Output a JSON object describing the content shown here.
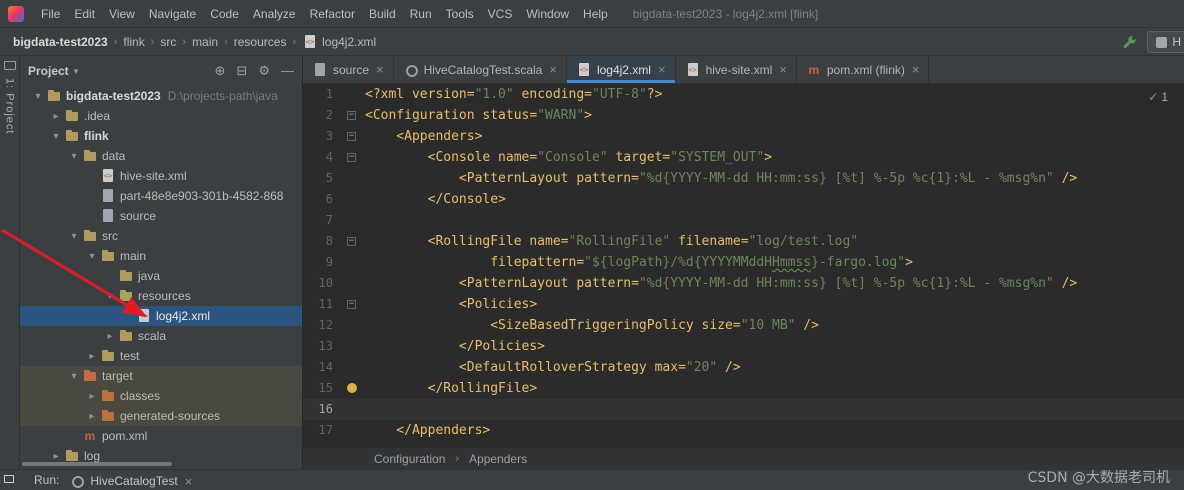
{
  "title_bar": {
    "menus": [
      "File",
      "Edit",
      "View",
      "Navigate",
      "Code",
      "Analyze",
      "Refactor",
      "Build",
      "Run",
      "Tools",
      "VCS",
      "Window",
      "Help"
    ],
    "window_title": "bigdata-test2023 - log4j2.xml [flink]"
  },
  "nav_bar": {
    "breadcrumbs": [
      "bigdata-test2023",
      "flink",
      "src",
      "main",
      "resources",
      "log4j2.xml"
    ],
    "run_widget_label": "H"
  },
  "tool_strip": {
    "label": "1: Project"
  },
  "project_panel": {
    "title": "Project",
    "tools": [
      {
        "name": "locate",
        "glyph": "⊕"
      },
      {
        "name": "collapse-all",
        "glyph": "⊟"
      },
      {
        "name": "settings",
        "glyph": "⚙"
      },
      {
        "name": "hide",
        "glyph": "—"
      }
    ],
    "tree": [
      {
        "label": "bigdata-test2023",
        "sub": "D:\\projects-path\\java",
        "icon": "folder",
        "indent": 0,
        "chevron": "down",
        "bold": true
      },
      {
        "label": ".idea",
        "icon": "folder",
        "indent": 1,
        "chevron": "right"
      },
      {
        "label": "flink",
        "icon": "folder",
        "indent": 1,
        "chevron": "down",
        "bold": true
      },
      {
        "label": "data",
        "icon": "folder",
        "indent": 2,
        "chevron": "down"
      },
      {
        "label": "hive-site.xml",
        "icon": "xml",
        "indent": 3
      },
      {
        "label": "part-48e8e903-301b-4582-868",
        "icon": "file",
        "indent": 3
      },
      {
        "label": "source",
        "icon": "file",
        "indent": 3
      },
      {
        "label": "src",
        "icon": "folder",
        "indent": 2,
        "chevron": "down"
      },
      {
        "label": "main",
        "icon": "folder",
        "indent": 3,
        "chevron": "down"
      },
      {
        "label": "java",
        "icon": "folder",
        "indent": 4
      },
      {
        "label": "resources",
        "icon": "folder-res",
        "indent": 4,
        "chevron": "down"
      },
      {
        "label": "log4j2.xml",
        "icon": "xml",
        "indent": 5,
        "selected": true
      },
      {
        "label": "scala",
        "icon": "folder",
        "indent": 4,
        "chevron": "right"
      },
      {
        "label": "test",
        "icon": "folder",
        "indent": 3,
        "chevron": "right"
      },
      {
        "label": "target",
        "icon": "folder-ex",
        "indent": 2,
        "chevron": "down",
        "band": true
      },
      {
        "label": "classes",
        "icon": "folder-ex",
        "indent": 3,
        "chevron": "right",
        "band": true
      },
      {
        "label": "generated-sources",
        "icon": "folder-ex",
        "indent": 3,
        "chevron": "right",
        "band": true
      },
      {
        "label": "pom.xml",
        "icon": "maven",
        "indent": 2
      },
      {
        "label": "log",
        "icon": "folder",
        "indent": 1,
        "chevron": "right"
      }
    ]
  },
  "editor_tabs": [
    {
      "label": "source",
      "icon": "file"
    },
    {
      "label": "HiveCatalogTest.scala",
      "icon": "scala"
    },
    {
      "label": "log4j2.xml",
      "icon": "xml",
      "active": true
    },
    {
      "label": "hive-site.xml",
      "icon": "xml"
    },
    {
      "label": "pom.xml (flink)",
      "icon": "maven"
    }
  ],
  "editor": {
    "inspection": {
      "icon": "check",
      "count": "1"
    },
    "lines": [
      {
        "n": 1,
        "seg": [
          [
            "t",
            "<?xml version="
          ],
          [
            "s",
            "\"1.0\""
          ],
          [
            "t",
            " encoding="
          ],
          [
            "s",
            "\"UTF-8\""
          ],
          [
            "t",
            "?>"
          ]
        ]
      },
      {
        "n": 2,
        "fold": true,
        "seg": [
          [
            "t",
            "<Configuration status="
          ],
          [
            "s",
            "\"WARN\""
          ],
          [
            "t",
            ">"
          ]
        ]
      },
      {
        "n": 3,
        "fold": true,
        "seg": [
          [
            "t",
            "    <Appenders>"
          ]
        ]
      },
      {
        "n": 4,
        "fold": true,
        "seg": [
          [
            "t",
            "        <Console name="
          ],
          [
            "s",
            "\"Console\""
          ],
          [
            "t",
            " target="
          ],
          [
            "s",
            "\"SYSTEM_OUT\""
          ],
          [
            "t",
            ">"
          ]
        ]
      },
      {
        "n": 5,
        "seg": [
          [
            "t",
            "            <PatternLayout pattern="
          ],
          [
            "s",
            "\"%d{YYYY-MM-dd HH:mm:ss} [%t] %-5p %c{1}:%L - %msg%n\""
          ],
          [
            "t",
            " />"
          ]
        ]
      },
      {
        "n": 6,
        "seg": [
          [
            "t",
            "        </Console>"
          ]
        ]
      },
      {
        "n": 7,
        "seg": []
      },
      {
        "n": 8,
        "fold": true,
        "seg": [
          [
            "t",
            "        <RollingFile name="
          ],
          [
            "s",
            "\"RollingFile\""
          ],
          [
            "t",
            " filename="
          ],
          [
            "s",
            "\"log/test.log\""
          ]
        ]
      },
      {
        "n": 9,
        "seg": [
          [
            "t",
            "                filepattern="
          ],
          [
            "s",
            "\"${logPath}/%d{YYYYMMddH"
          ],
          [
            "y",
            "Hmmss"
          ],
          [
            "s",
            "}-fargo.log\""
          ],
          [
            "t",
            ">"
          ]
        ]
      },
      {
        "n": 10,
        "seg": [
          [
            "t",
            "            <PatternLayout pattern="
          ],
          [
            "s",
            "\"%d{YYYY-MM-dd HH:mm:ss} [%t] %-5p %c{1}:%L - %msg%n\""
          ],
          [
            "t",
            " />"
          ]
        ]
      },
      {
        "n": 11,
        "fold": true,
        "seg": [
          [
            "t",
            "            <Policies>"
          ]
        ]
      },
      {
        "n": 12,
        "seg": [
          [
            "t",
            "                <SizeBasedTriggeringPolicy size="
          ],
          [
            "s",
            "\"10 MB\""
          ],
          [
            "t",
            " />"
          ]
        ]
      },
      {
        "n": 13,
        "seg": [
          [
            "t",
            "            </Policies>"
          ]
        ]
      },
      {
        "n": 14,
        "seg": [
          [
            "t",
            "            <DefaultRolloverStrategy max="
          ],
          [
            "s",
            "\"20\""
          ],
          [
            "t",
            " />"
          ]
        ]
      },
      {
        "n": 15,
        "bulb": true,
        "seg": [
          [
            "t",
            "        </RollingFile>"
          ]
        ]
      },
      {
        "n": 16,
        "current": true,
        "seg": []
      },
      {
        "n": 17,
        "seg": [
          [
            "t",
            "    </Appenders>"
          ]
        ]
      }
    ]
  },
  "status_breadcrumbs": [
    "Configuration",
    "Appenders"
  ],
  "run_panel": {
    "label": "Run:",
    "tab": "HiveCatalogTest"
  },
  "watermark": "CSDN @大数据老司机"
}
